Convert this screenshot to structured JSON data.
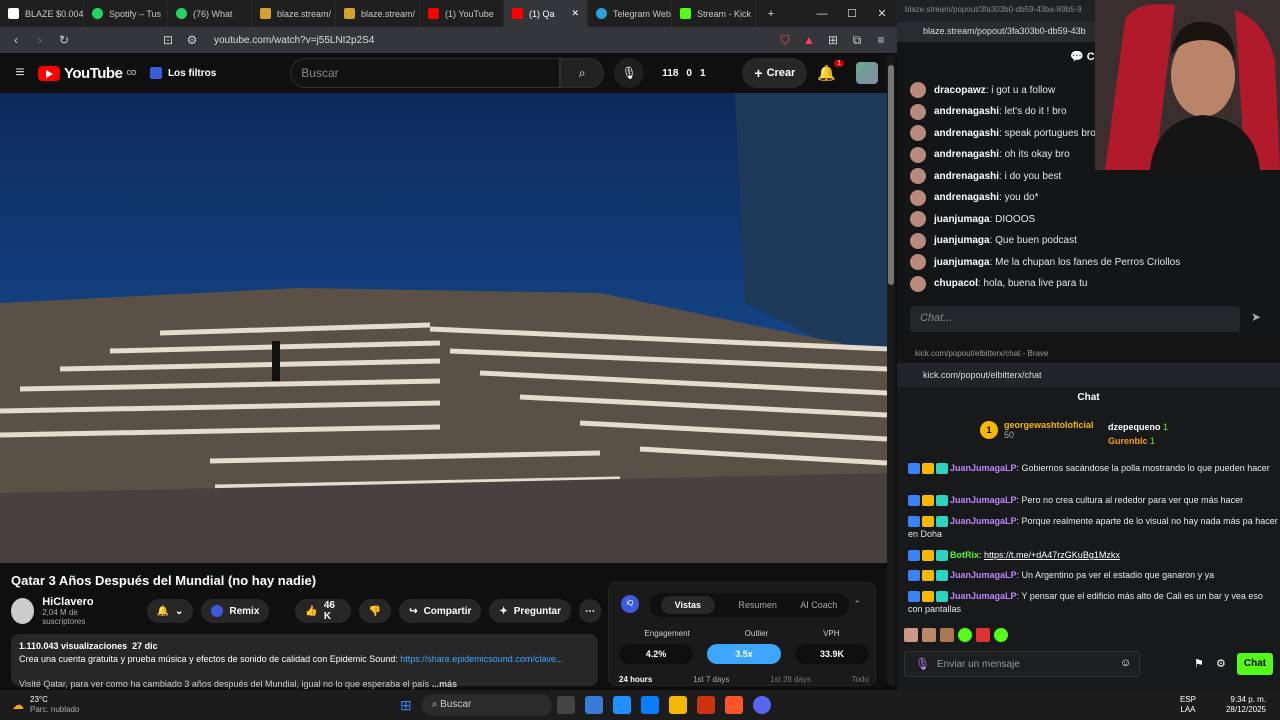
{
  "tabs": [
    {
      "label": "BLAZE $0.0046",
      "color": "#ffffff"
    },
    {
      "label": "Spotify – Tus",
      "color": "#1ed760"
    },
    {
      "label": "(76) What",
      "color": "#25d366"
    },
    {
      "label": "blaze.stream/",
      "color": "#d4a12a"
    },
    {
      "label": "blaze.stream/",
      "color": "#d4a12a"
    },
    {
      "label": "(1) YouTube",
      "color": "#ff0000"
    },
    {
      "label": "(1) Qa",
      "color": "#ff0000"
    },
    {
      "label": "Telegram Web",
      "color": "#2aa1da"
    },
    {
      "label": "Stream - Kick",
      "color": "#53fc18"
    }
  ],
  "window_controls": {
    "new_tab": "+",
    "minimize": "—",
    "maximize": "☐",
    "close": "✕"
  },
  "address": {
    "url": "youtube.com/watch?v=j55LNI2p2S4",
    "badge": "1"
  },
  "yt": {
    "logo": "YouTube",
    "logo_sup": "CO",
    "filters": "Los filtros",
    "search_placeholder": "Buscar",
    "stats": {
      "a": "118",
      "b": "0",
      "c": "1"
    },
    "create": "Crear",
    "notif": "1"
  },
  "video": {
    "title": "Qatar 3 Años Después del Mundial (no hay nadie)",
    "channel": "HiClavero",
    "subs": "2,04 M de suscriptores",
    "remix": "Remix",
    "likes": "46 K",
    "share": "Compartir",
    "ask": "Preguntar",
    "views": "1.110.043 visualizaciones",
    "date": "27 dic",
    "desc1": "Crea una cuenta gratuita y prueba música y efectos de sonido de calidad con Epidemic Sound:",
    "desc_link": "https://share.epidemicsound.com/clave...",
    "desc2": "Visité Qatar, para ver como ha cambiado 3 años después del Mundial, igual no lo que esperaba el país",
    "more": "...más"
  },
  "stats_panel": {
    "tabs": [
      "Vistas",
      "Resumen",
      "AI Coach"
    ],
    "labels": [
      "Engagement",
      "Outlier",
      "VPH"
    ],
    "values": [
      "4.2%",
      "3.5x",
      "33.9K"
    ],
    "periods": [
      "24 hours",
      "1st 7 days",
      "1st 28 days",
      "Todo"
    ]
  },
  "blaze_chat": {
    "url": "blaze.stream/popout/3fa303b0-db59-43ba-89b5-9",
    "url2": "blaze.stream/popout/3fa303b0-db59-43b",
    "header": "Ch",
    "messages": [
      {
        "user": "dracopawz",
        "text": "i got u a follow"
      },
      {
        "user": "andrenagashi",
        "text": "let's do it ! bro"
      },
      {
        "user": "andrenagashi",
        "text": "speak portugues bro?"
      },
      {
        "user": "andrenagashi",
        "text": "oh its okay bro"
      },
      {
        "user": "andrenagashi",
        "text": "i do you best"
      },
      {
        "user": "andrenagashi",
        "text": "you do*"
      },
      {
        "user": "juanjumaga",
        "text": "DIOOOS"
      },
      {
        "user": "juanjumaga",
        "text": "Que buen podcast"
      },
      {
        "user": "juanjumaga",
        "text": "Me la chupan los fanes de Perros Criollos"
      },
      {
        "user": "chupacol",
        "text": "hola, buena live para tu"
      }
    ],
    "input_placeholder": "Chat..."
  },
  "kick": {
    "window_title": "kick.com/popout/elbitterx/chat - Brave",
    "url": "kick.com/popout/elbitterx/chat",
    "header": "Chat",
    "top_gifter": {
      "rank": "1",
      "name": "georgewashtoloficial",
      "amount": "50"
    },
    "gifters": [
      {
        "name": "dzepequeno",
        "amount": "1"
      },
      {
        "name": "Gurenblc",
        "amount": "1"
      }
    ],
    "messages": [
      {
        "user": "JuanJumagaLP",
        "text": "Gobiernos sacándose la polla mostrando lo que pueden hacer"
      },
      {
        "user": "JuanJumagaLP",
        "text": "Pero no crea cultura al rededor para ver que más hacer"
      },
      {
        "user": "JuanJumagaLP",
        "text": "Porque realmente aparte de lo visual no hay nada más pa hacer en Doha"
      },
      {
        "user": "BotRix",
        "text": "https://t.me/+dA47rzGKuBg1Mzkx"
      },
      {
        "user": "JuanJumagaLP",
        "text": "Un Argentino pa ver el estadio que ganaron y ya"
      },
      {
        "user": "JuanJumagaLP",
        "text": "Y pensar que el edificio más alto de Cali es un bar y vea eso con pantallas"
      }
    ],
    "input_placeholder": "Enviar un mensaje",
    "chat_button": "Chat"
  },
  "taskbar": {
    "temp": "23°C",
    "weather": "Parc. nublado",
    "search": "Buscar",
    "lang1": "ESP",
    "lang2": "LAA",
    "time": "9:34 p. m.",
    "date": "28/12/2025"
  }
}
